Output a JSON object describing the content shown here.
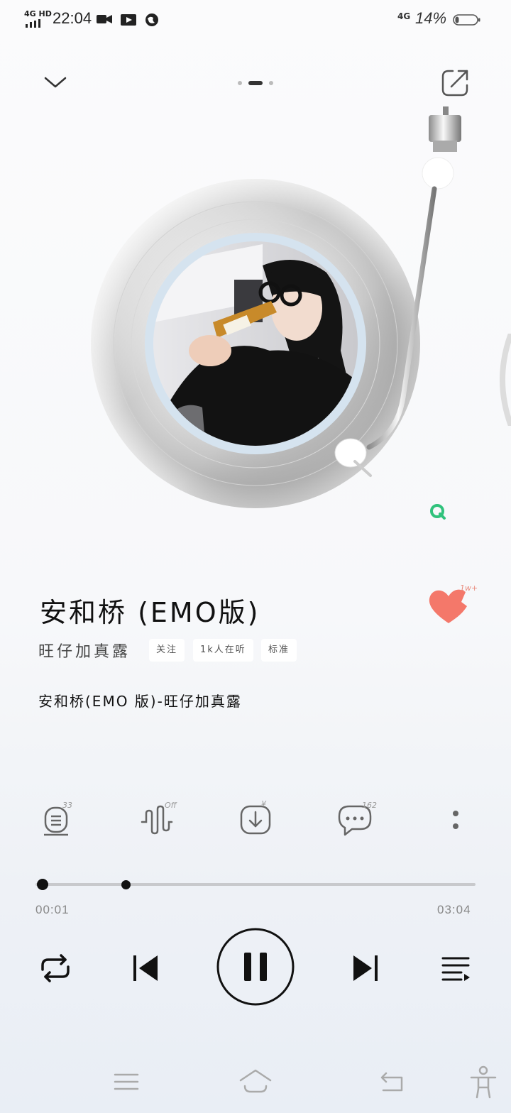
{
  "status_bar": {
    "network": "4G HD",
    "time": "22:04",
    "network_right": "4G",
    "battery": "14%"
  },
  "header": {
    "page_indicator_count": 3,
    "page_indicator_active": 2
  },
  "song": {
    "title": "安和桥 (EMO版)",
    "artist": "旺仔加真露",
    "like_count": "1w+",
    "tags": {
      "follow": "关注",
      "listeners": "1k人在听",
      "quality": "标准"
    },
    "lyric": "安和桥(EMO 版)-旺仔加真露"
  },
  "actions": {
    "lyrics_badge": "33",
    "effect_badge": "Off",
    "download_badge": "¥",
    "comment_badge": "162"
  },
  "player": {
    "elapsed": "00:01",
    "total": "03:04",
    "progress_fraction": 0.005
  },
  "colors": {
    "accent_heart": "#f4786a",
    "qq_green": "#31c27c",
    "label_ring": "#d5e3ef"
  },
  "icons": {
    "collapse": "chevron-down-icon",
    "share": "share-icon",
    "repeat": "repeat-icon",
    "prev": "skip-previous-icon",
    "play_pause": "pause-icon",
    "next": "skip-next-icon",
    "playlist": "playlist-icon"
  }
}
